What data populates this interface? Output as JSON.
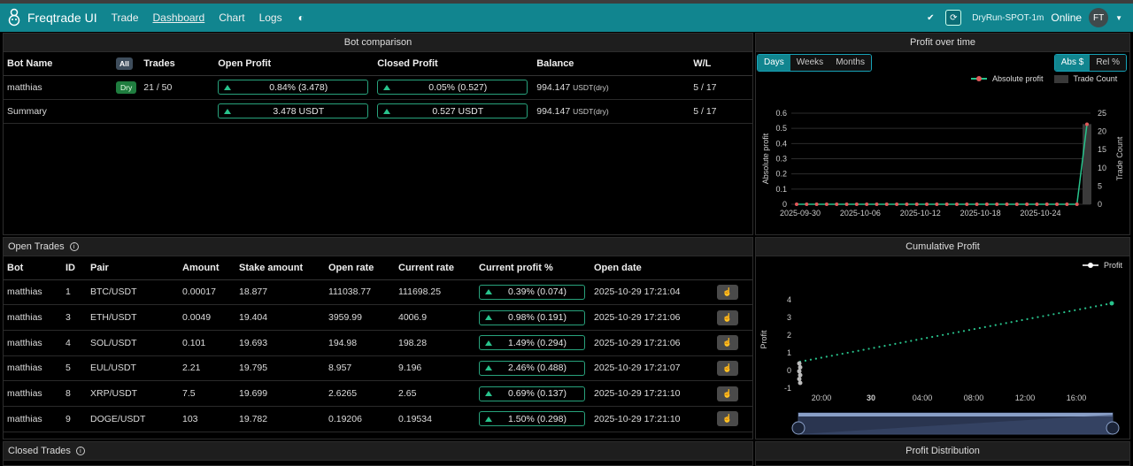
{
  "nav": {
    "brand": "Freqtrade UI",
    "links": [
      "Trade",
      "Dashboard",
      "Chart",
      "Logs"
    ],
    "bot_name": "DryRun-SPOT-1m",
    "status": "Online",
    "avatar": "FT"
  },
  "bot_comparison": {
    "title": "Bot comparison",
    "headers": [
      "Bot Name",
      "All",
      "Trades",
      "Open Profit",
      "Closed Profit",
      "Balance",
      "W/L"
    ],
    "rows": [
      {
        "name": "matthias",
        "badge": "Dry",
        "trades": "21 / 50",
        "open_profit": "0.84% (3.478)",
        "closed_profit": "0.05% (0.527)",
        "balance": "994.147",
        "balance_unit": "USDT(dry)",
        "wl": "5 / 17"
      },
      {
        "name": "Summary",
        "badge": "",
        "trades": "",
        "open_profit": "3.478 USDT",
        "closed_profit": "0.527 USDT",
        "balance": "994.147",
        "balance_unit": "USDT(dry)",
        "wl": "5 / 17"
      }
    ]
  },
  "profit_over_time": {
    "title": "Profit over time",
    "periods": [
      "Days",
      "Weeks",
      "Months"
    ],
    "modes": [
      "Abs $",
      "Rel %"
    ],
    "legend": [
      "Absolute profit",
      "Trade Count"
    ]
  },
  "open_trades": {
    "title": "Open Trades",
    "headers": [
      "Bot",
      "ID",
      "Pair",
      "Amount",
      "Stake amount",
      "Open rate",
      "Current rate",
      "Current profit %",
      "Open date"
    ],
    "rows": [
      {
        "bot": "matthias",
        "id": "1",
        "pair": "BTC/USDT",
        "amount": "0.00017",
        "stake": "18.877",
        "open_rate": "111038.77",
        "current_rate": "111698.25",
        "profit": "0.39% (0.074)",
        "date": "2025-10-29 17:21:04"
      },
      {
        "bot": "matthias",
        "id": "3",
        "pair": "ETH/USDT",
        "amount": "0.0049",
        "stake": "19.404",
        "open_rate": "3959.99",
        "current_rate": "4006.9",
        "profit": "0.98% (0.191)",
        "date": "2025-10-29 17:21:06"
      },
      {
        "bot": "matthias",
        "id": "4",
        "pair": "SOL/USDT",
        "amount": "0.101",
        "stake": "19.693",
        "open_rate": "194.98",
        "current_rate": "198.28",
        "profit": "1.49% (0.294)",
        "date": "2025-10-29 17:21:06"
      },
      {
        "bot": "matthias",
        "id": "5",
        "pair": "EUL/USDT",
        "amount": "2.21",
        "stake": "19.795",
        "open_rate": "8.957",
        "current_rate": "9.196",
        "profit": "2.46% (0.488)",
        "date": "2025-10-29 17:21:07"
      },
      {
        "bot": "matthias",
        "id": "8",
        "pair": "XRP/USDT",
        "amount": "7.5",
        "stake": "19.699",
        "open_rate": "2.6265",
        "current_rate": "2.65",
        "profit": "0.69% (0.137)",
        "date": "2025-10-29 17:21:10"
      },
      {
        "bot": "matthias",
        "id": "9",
        "pair": "DOGE/USDT",
        "amount": "103",
        "stake": "19.782",
        "open_rate": "0.19206",
        "current_rate": "0.19534",
        "profit": "1.50% (0.298)",
        "date": "2025-10-29 17:21:10"
      }
    ]
  },
  "cumulative_profit": {
    "title": "Cumulative Profit",
    "legend": "Profit"
  },
  "closed_trades": {
    "title": "Closed Trades"
  },
  "profit_distribution": {
    "title": "Profit Distribution"
  },
  "colors": {
    "accent": "#11858f",
    "profit_line": "#28c38c",
    "marker": "#e05a5a"
  },
  "chart_data": [
    {
      "type": "line",
      "title": "Profit over time",
      "x": [
        "2025-09-30",
        "2025-10-06",
        "2025-10-12",
        "2025-10-18",
        "2025-10-24"
      ],
      "ylabel": "Absolute profit",
      "y2label": "Trade Count",
      "ylim": [
        0,
        0.6
      ],
      "y2lim": [
        0,
        25
      ],
      "yticks": [
        0,
        0.1,
        0.2,
        0.3,
        0.4,
        0.5,
        0.6
      ],
      "y2ticks": [
        0,
        5,
        10,
        15,
        20,
        25
      ],
      "series": [
        {
          "name": "Absolute profit",
          "values": [
            0,
            0,
            0,
            0,
            0,
            0,
            0,
            0,
            0,
            0,
            0,
            0,
            0,
            0,
            0,
            0,
            0,
            0,
            0,
            0,
            0,
            0,
            0,
            0,
            0,
            0,
            0,
            0,
            0,
            0.527
          ]
        },
        {
          "name": "Trade Count",
          "values": [
            0,
            0,
            0,
            0,
            0,
            0,
            0,
            0,
            0,
            0,
            0,
            0,
            0,
            0,
            0,
            0,
            0,
            0,
            0,
            0,
            0,
            0,
            0,
            0,
            0,
            0,
            0,
            0,
            0,
            22
          ]
        }
      ],
      "legend": "top-right",
      "grid": true
    },
    {
      "type": "scatter",
      "title": "Cumulative Profit",
      "ylabel": "Profit",
      "xticks": [
        "20:00",
        "30",
        "04:00",
        "08:00",
        "12:00",
        "16:00"
      ],
      "yticks": [
        -1,
        0,
        1,
        2,
        3,
        4
      ],
      "ylim": [
        -1,
        4.5
      ],
      "series": [
        {
          "name": "Profit",
          "start": 0.5,
          "end": 3.8
        }
      ],
      "legend": "top-right"
    }
  ]
}
